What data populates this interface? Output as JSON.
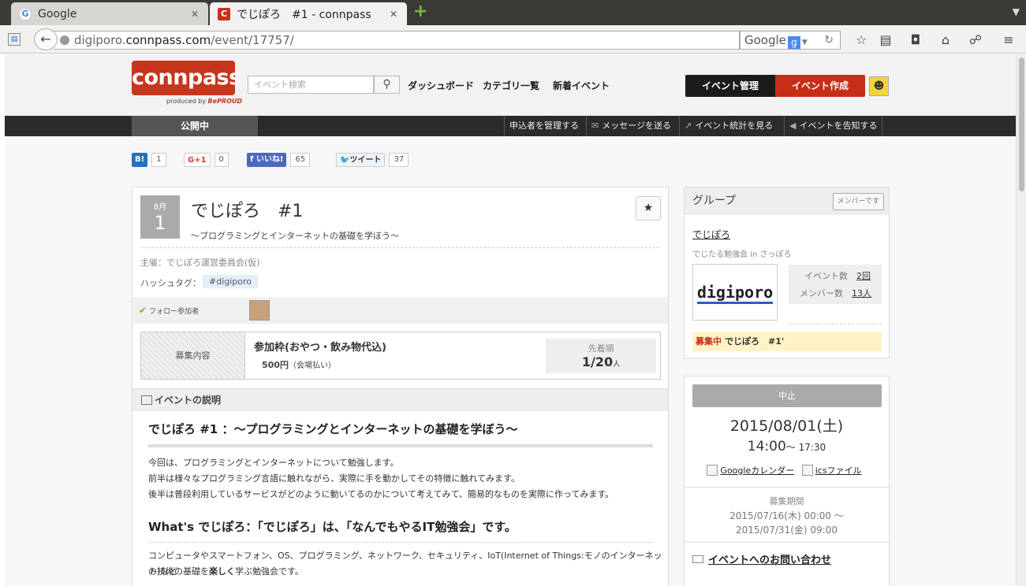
{
  "browser": {
    "tabs": [
      {
        "title": "Google",
        "icon": "google-g-icon"
      },
      {
        "title": "でじぽろ　#1 - connpass",
        "icon": "connpass-c-icon"
      }
    ],
    "url": {
      "scheme_host_prefix": "digiporo.",
      "host": "connpass.com",
      "path": "/event/17757/"
    },
    "search_engine": "Google"
  },
  "header": {
    "logo": "connpass",
    "logo_sub_prefix": "produced by",
    "logo_sub_brand": "BePROUD",
    "search_placeholder": "イベント検索",
    "nav": [
      "ダッシュボード",
      "カテゴリ一覧",
      "新着イベント"
    ],
    "btn_manage": "イベント管理",
    "btn_create": "イベント作成"
  },
  "subbar": {
    "status_tab": "公開中",
    "actions": [
      "申込者を管理する",
      "メッセージを送る",
      "イベント統計を見る",
      "イベントを告知する"
    ]
  },
  "social": {
    "hatena": {
      "label": "B!",
      "count": "1"
    },
    "gplus": {
      "label": "G+1",
      "count": "0"
    },
    "facebook": {
      "label": "いいね!",
      "count": "65"
    },
    "twitter": {
      "label": "ツイート",
      "count": "37"
    }
  },
  "event": {
    "month": "8月",
    "day": "1",
    "title": "でじぽろ　#1",
    "subtitle": "～プログラミングとインターネットの基礎を学ぼう～",
    "organizer": "主催：でじぽろ運営委員会(仮)",
    "hashtag_label": "ハッシュタグ：",
    "hashtag": "#digiporo",
    "follow_label": "フォロー参加者",
    "ticket_label": "募集内容",
    "ticket_name": "参加枠(おやつ・飲み物代込)",
    "ticket_price": "500円",
    "ticket_price_note": "（会場払い）",
    "ticket_type": "先着順",
    "ticket_count": "1/20",
    "ticket_unit": "人"
  },
  "description": {
    "heading": "イベントの説明",
    "h2_1": "でじぽろ #1 ：～プログラミングとインターネットの基礎を学ぼう～",
    "p1": [
      "今回は、プログラミングとインターネットについて勉強します。",
      "前半は様々なプログラミング言語に触れながら、実際に手を動かしてその特徴に触れてみます。",
      "後半は普段利用しているサービスがどのように動いてるのかについて考えてみて、簡易的なものを実際に作ってみます。"
    ],
    "h2_2": "What's でじぽろ：「でじぽろ」は、「なんでもやるIT勉強会」です。",
    "p2_line1": "コンピュータやスマートフォン、OS、プログラミング、ネットワーク、セキュリティ、IoT(Internet of Things:モノのインターネット)など",
    "p2_line2_pre": "の技術の基礎を",
    "p2_line2_bold": "楽しく",
    "p2_line2_post": "学ぶ勉強会です。"
  },
  "group": {
    "heading": "グループ",
    "member_btn": "メンバーです",
    "name": "でじぽろ",
    "desc": "でじたる勉強会 in さっぽろ",
    "logo_text": "digiporo",
    "events_label": "イベント数",
    "events_value": "2回",
    "members_label": "メンバー数",
    "members_value": "13人",
    "recruit_tag": "募集中",
    "recruit_event": "でじぽろ　#1'"
  },
  "schedule": {
    "cancel": "中止",
    "date": "2015/08/01(土)",
    "start": "14:00",
    "end": "～ 17:30",
    "gcal": "Googleカレンダー",
    "ics": "icsファイル",
    "period_label": "募集期間",
    "period_start": "2015/07/16(木) 00:00 ～",
    "period_end": "2015/07/31(金) 09:00",
    "contact": "イベントへのお問い合わせ"
  }
}
